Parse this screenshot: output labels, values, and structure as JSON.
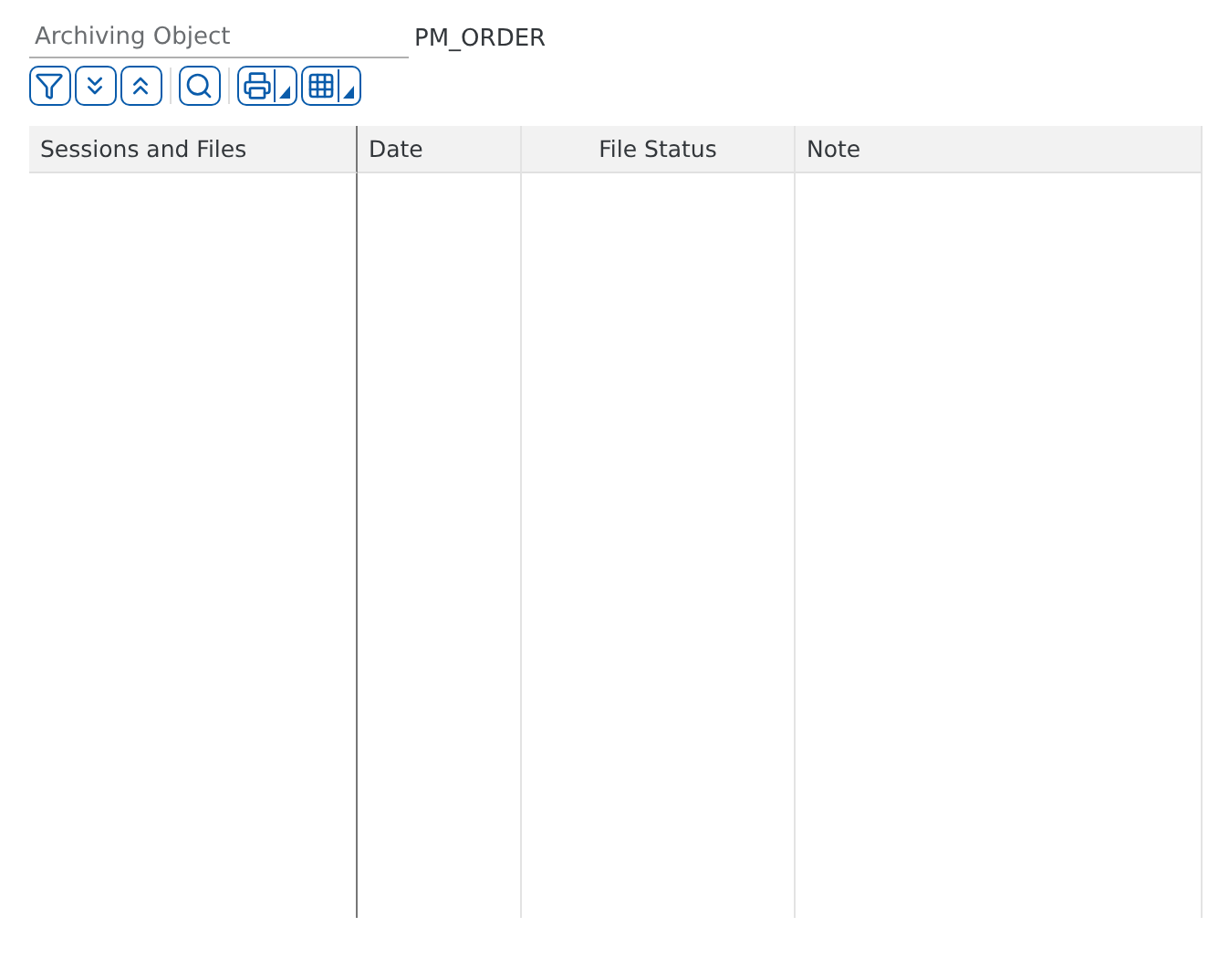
{
  "field": {
    "label": "Archiving Object",
    "value": "PM_ORDER"
  },
  "toolbar": [
    {
      "kind": "filter"
    },
    {
      "kind": "expand"
    },
    {
      "kind": "collapse"
    },
    {
      "kind": "search"
    },
    {
      "kind": "print",
      "menu": true
    },
    {
      "kind": "layout",
      "menu": true
    }
  ],
  "table": {
    "columns": [
      {
        "label": "Sessions and Files",
        "centered": false
      },
      {
        "label": "Date",
        "centered": false
      },
      {
        "label": "File Status",
        "centered": true
      },
      {
        "label": "Note",
        "centered": false
      }
    ]
  }
}
